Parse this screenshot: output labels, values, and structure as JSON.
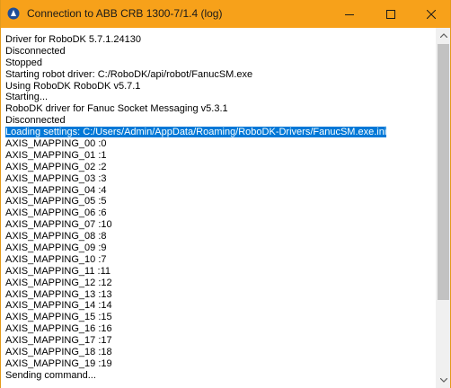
{
  "window": {
    "title": "Connection to ABB CRB 1300-7/1.4 (log)",
    "accent_color": "#f7a11a",
    "selection_color": "#0078d7",
    "icons": {
      "app": "robodk-app-icon",
      "minimize": "minimize-icon",
      "maximize": "maximize-icon",
      "close": "close-icon"
    }
  },
  "log": {
    "selected_index": 8,
    "lines": [
      "Driver for RoboDK 5.7.1.24130",
      "Disconnected",
      "Stopped",
      "Starting robot driver: C:/RoboDK/api/robot/FanucSM.exe",
      "Using RoboDK RoboDK v5.7.1",
      "Starting...",
      "RoboDK driver for Fanuc Socket Messaging v5.3.1",
      "Disconnected",
      "Loading settings: C:/Users/Admin/AppData/Roaming/RoboDK-Drivers/FanucSM.exe.ini",
      "AXIS_MAPPING_00 :0",
      "AXIS_MAPPING_01 :1",
      "AXIS_MAPPING_02 :2",
      "AXIS_MAPPING_03 :3",
      "AXIS_MAPPING_04 :4",
      "AXIS_MAPPING_05 :5",
      "AXIS_MAPPING_06 :6",
      "AXIS_MAPPING_07 :10",
      "AXIS_MAPPING_08 :8",
      "AXIS_MAPPING_09 :9",
      "AXIS_MAPPING_10 :7",
      "AXIS_MAPPING_11 :11",
      "AXIS_MAPPING_12 :12",
      "AXIS_MAPPING_13 :13",
      "AXIS_MAPPING_14 :14",
      "AXIS_MAPPING_15 :15",
      "AXIS_MAPPING_16 :16",
      "AXIS_MAPPING_17 :17",
      "AXIS_MAPPING_18 :18",
      "AXIS_MAPPING_19 :19",
      "Sending command..."
    ]
  },
  "scrollbar": {
    "position_fraction": 0.0,
    "visible_fraction": 0.78
  }
}
